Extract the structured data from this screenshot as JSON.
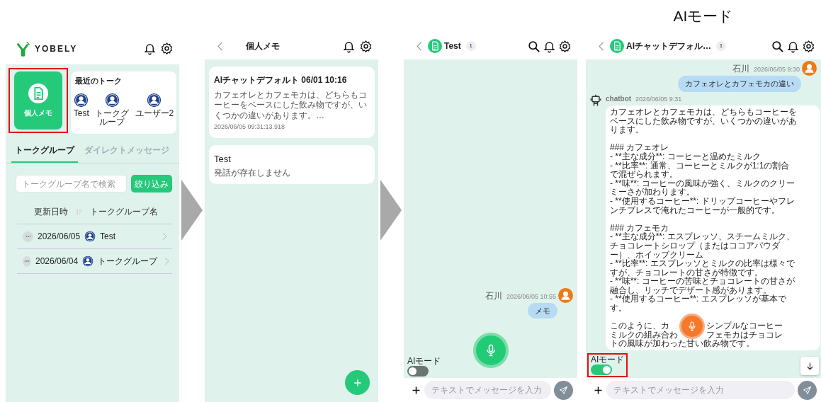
{
  "caption": "AIモード",
  "screens": [
    {
      "kind": "home",
      "arrow_after": true,
      "header": {
        "logo": "YOBELY"
      },
      "memo_tile": {
        "label": "個人メモ",
        "highlighted": true
      },
      "recent": {
        "title": "最近のトーク",
        "items": [
          {
            "label": "Test"
          },
          {
            "label": "トークグループ"
          },
          {
            "label": "ユーザー2"
          }
        ]
      },
      "tabs": [
        {
          "label": "トークグループ",
          "selected": true
        },
        {
          "label": "ダイレクトメッセージ",
          "selected": false
        }
      ],
      "search": {
        "placeholder": "トークグループ名で検索",
        "button": "絞り込み"
      },
      "columns": [
        "更新日時",
        "トークグループ名"
      ],
      "rows": [
        {
          "date": "2026/06/05",
          "name": "Test"
        },
        {
          "date": "2026/06/04",
          "name": "トークグループ"
        }
      ]
    },
    {
      "kind": "memo_list",
      "arrow_after": true,
      "header": {
        "title": "個人メモ"
      },
      "memos": [
        {
          "title": "AIチャットデフォルト 06/01 10:16",
          "preview": "カフェオレとカフェモカは、どちらもコーヒーをベースにした飲み物ですが、いくつかの違いがあります。…",
          "time": "2026/06/05 09:31:13.918"
        },
        {
          "title": "Test",
          "preview": "発話が存在しません"
        }
      ]
    },
    {
      "kind": "chat",
      "arrow_after": false,
      "header": {
        "title": "Test",
        "badge": "1"
      },
      "messages": [
        {
          "kind": "user",
          "sender": "石川",
          "time": "2026/06/05 10:55",
          "text": "メモ"
        }
      ],
      "ai_mode": {
        "label": "AIモード",
        "on": false,
        "highlighted": false
      },
      "scroll_down_button": false,
      "input": {
        "placeholder": "テキストでメッセージを入力"
      }
    },
    {
      "kind": "chat",
      "arrow_after": false,
      "header": {
        "title": "AIチャットデフォル…",
        "badge": "1"
      },
      "messages": [
        {
          "kind": "user",
          "sender": "石川",
          "time": "2026/06/05 9:30",
          "text": "カフェオレとカフェモカの違い"
        },
        {
          "kind": "bot",
          "sender": "chatbot",
          "time": "2026/06/05 9:31",
          "paragraphs": [
            [
              "カフェオレとカフェモカは、どちらもコーヒーを",
              "ベースにした飲み物ですが、いくつかの違いがあ",
              "ります。"
            ],
            [
              "### カフェオレ",
              "- **主な成分**: コーヒーと温めたミルク",
              "- **比率**: 通常、コーヒーとミルクが1:1の割合",
              "で混ぜられます。",
              "- **味**: コーヒーの風味が強く、ミルクのクリー",
              "ミーさが加わります。",
              "- **使用するコーヒー**: ドリップコーヒーやフレ",
              "ンチプレスで淹れたコーヒーが一般的です。"
            ],
            [
              "### カフェモカ",
              "- **主な成分**: エスプレッソ、スチームミルク、",
              "チョコレートシロップ（またはココアパウダ",
              "ー）、ホイップクリーム",
              "- **比率**: エスプレッソとミルクの比率は様々で",
              "すが、チョコレートの甘さが特徴です。",
              "- **味**: コーヒーの苦味とチョコレートの甘さが",
              "融合し、リッチでデザート感があります。",
              "- **使用するコーヒー**: エスプレッソが基本で",
              "す。"
            ]
          ],
          "covered_lines": [
            [
              "このように、カ",
              "シンプルなコーヒー"
            ],
            [
              "ミルクの組み合わ",
              "フェモカはチョコレ"
            ],
            [
              "トの風味が加わった甘い飲み物です。"
            ]
          ]
        }
      ],
      "ai_mode": {
        "label": "AIモード",
        "on": true,
        "highlighted": true
      },
      "scroll_down_button": true,
      "input": {
        "placeholder": "テキストでメッセージを入力"
      }
    }
  ]
}
